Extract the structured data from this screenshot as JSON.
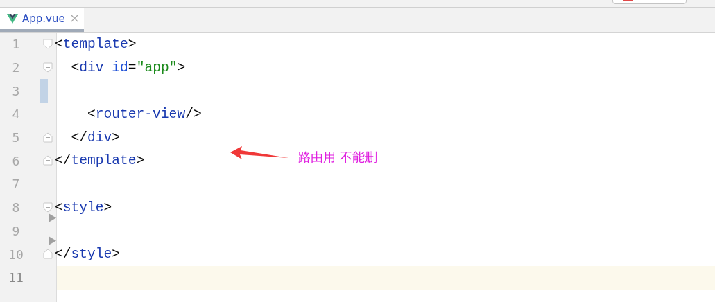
{
  "tabs": [
    {
      "label": "App.vue",
      "selected": true
    }
  ],
  "lines": [
    {
      "number": "1",
      "fold_start": true,
      "tokens": [
        {
          "kind": "punct",
          "text": "<"
        },
        {
          "kind": "tag",
          "text": "template"
        },
        {
          "kind": "punct",
          "text": ">"
        }
      ]
    },
    {
      "number": "2",
      "fold_start": true,
      "tokens": [
        {
          "kind": "punct",
          "text": "  <"
        },
        {
          "kind": "tag",
          "text": "div "
        },
        {
          "kind": "attr",
          "text": "id"
        },
        {
          "kind": "punct",
          "text": "="
        },
        {
          "kind": "string",
          "text": "\"app\""
        },
        {
          "kind": "punct",
          "text": ">"
        }
      ]
    },
    {
      "number": "3",
      "changed": true,
      "guide": true
    },
    {
      "number": "4",
      "guide": true,
      "tokens": [
        {
          "kind": "punct",
          "text": "    <"
        },
        {
          "kind": "tag",
          "text": "router-view"
        },
        {
          "kind": "punct",
          "text": "/>"
        }
      ]
    },
    {
      "number": "5",
      "fold_end": true,
      "tokens": [
        {
          "kind": "punct",
          "text": "  </"
        },
        {
          "kind": "tag",
          "text": "div"
        },
        {
          "kind": "punct",
          "text": ">"
        }
      ]
    },
    {
      "number": "6",
      "fold_end": true,
      "tokens": [
        {
          "kind": "punct",
          "text": "</"
        },
        {
          "kind": "tag",
          "text": "template"
        },
        {
          "kind": "punct",
          "text": ">"
        }
      ]
    },
    {
      "number": "7"
    },
    {
      "number": "8",
      "fold_start": true,
      "tokens": [
        {
          "kind": "punct",
          "text": "<"
        },
        {
          "kind": "tag",
          "text": "style"
        },
        {
          "kind": "punct",
          "text": ">"
        }
      ]
    },
    {
      "number": "9",
      "marker": true
    },
    {
      "number": "10",
      "fold_end": true,
      "marker": true,
      "tokens": [
        {
          "kind": "punct",
          "text": "</"
        },
        {
          "kind": "tag",
          "text": "style"
        },
        {
          "kind": "punct",
          "text": ">"
        }
      ]
    },
    {
      "number": "11",
      "current": true
    }
  ],
  "annotation": {
    "text": "路由用 不能删",
    "color": "#e020e0"
  }
}
